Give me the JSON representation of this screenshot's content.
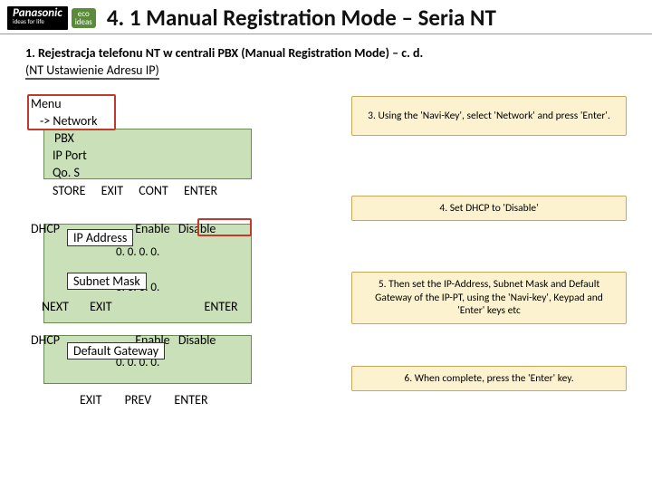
{
  "header": {
    "brand": "Panasonic",
    "brand_tag": "ideas for life",
    "eco1": "eco",
    "eco2": "ideas",
    "title": "4. 1 Manual Registration Mode – Seria NT"
  },
  "step": {
    "heading": "1. Rejestracja telefonu NT w centrali PBX (Manual Registration Mode) – c. d.",
    "sub": "(NT Ustawienie Adresu IP)"
  },
  "menu": {
    "l1": "Menu",
    "l2": "-> Network",
    "l3": "PBX",
    "l4": "IP Port",
    "l5": "Qo. S",
    "btns": {
      "store": "STORE",
      "exit": "EXIT",
      "cont": "CONT",
      "enter": "ENTER"
    }
  },
  "block2": {
    "dhcp": "DHCP",
    "enable": "Enable",
    "disable": "Disable",
    "ipaddr_label": "IP Address",
    "ip1": "0.   0.   0.   0.",
    "subnet_label": "Subnet Mask",
    "ip2": "0.  0.  0.  0.",
    "btns": {
      "next": "NEXT",
      "exit": "EXIT",
      "enter": "ENTER"
    }
  },
  "block3": {
    "dhcp": "DHCP",
    "enable": "Enable",
    "disable": "Disable",
    "gw_label": "Default Gateway",
    "ip": "0.  0.  0.  0."
  },
  "final_btns": {
    "exit": "EXIT",
    "prev": "PREV",
    "enter": "ENTER"
  },
  "callouts": {
    "c3": "3. Using the 'Navi-Key', select 'Network' and press 'Enter'.",
    "c4": "4. Set DHCP to 'Disable'",
    "c5": "5. Then set the IP-Address, Subnet Mask and Default Gateway of the IP-PT, using the 'Navi-key', Keypad and 'Enter' keys etc",
    "c6": "6. When complete, press the 'Enter' key."
  }
}
